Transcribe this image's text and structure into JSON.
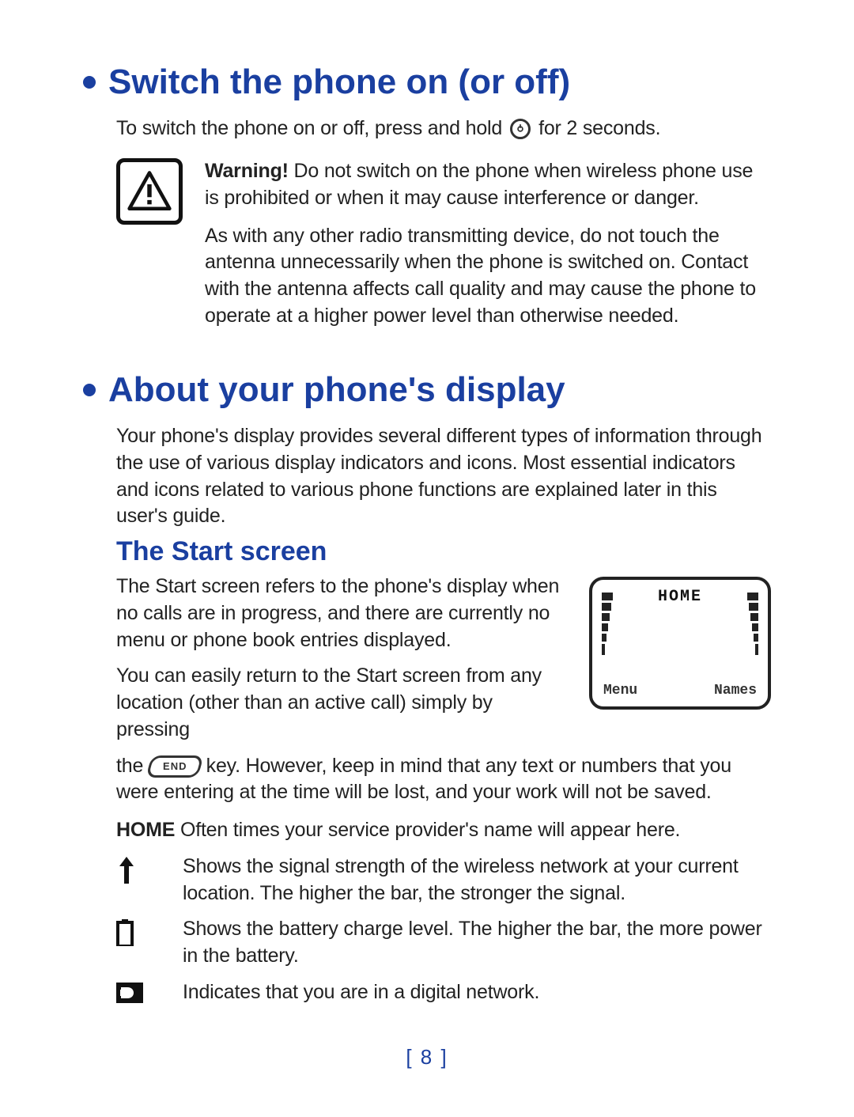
{
  "section1": {
    "heading": "Switch the phone on (or off)",
    "intro_before": "To switch the phone on or off, press and hold",
    "intro_after": "for 2 seconds.",
    "power_glyph": "⏻",
    "warning_label": "Warning!",
    "warning_line1": " Do not switch on the phone when wireless phone use is prohibited or when it may cause interference or danger.",
    "warning_line2": "As with any other radio transmitting device, do not touch the antenna unnecessarily when the phone is switched on. Contact with the antenna affects call quality and may cause the phone to operate at a higher power level than otherwise needed."
  },
  "section2": {
    "heading": "About your phone's display",
    "intro": "Your phone's display provides several different types of information through the use of various display indicators and icons. Most essential indicators and icons related to various phone functions are explained later in this user's guide.",
    "sub": "The Start screen",
    "p1": "The Start screen refers to the phone's display when no calls are in progress, and there are currently no menu or phone book entries displayed.",
    "p2a": "You can easily return to the Start screen from any location (other than an active call) simply by pressing",
    "p2b_before": "the",
    "end_label": "END",
    "p2b_after": "key. However, keep in mind that any text or numbers that you were entering at the time will be lost, and your work will not be saved.",
    "home_label": "HOME",
    "home_desc": " Often times your service provider's name will appear here.",
    "defs": [
      {
        "icon": "signal",
        "text": "Shows the signal strength of the wireless network at your current location. The higher the bar, the stronger the signal."
      },
      {
        "icon": "battery",
        "text": "Shows the battery charge level. The higher the bar, the more power in the battery."
      },
      {
        "icon": "digital",
        "text": "Indicates that you are in a digital network."
      }
    ],
    "screen": {
      "top": "HOME",
      "bottom_left": "Menu",
      "bottom_right": "Names"
    }
  },
  "page_number": "[ 8 ]"
}
